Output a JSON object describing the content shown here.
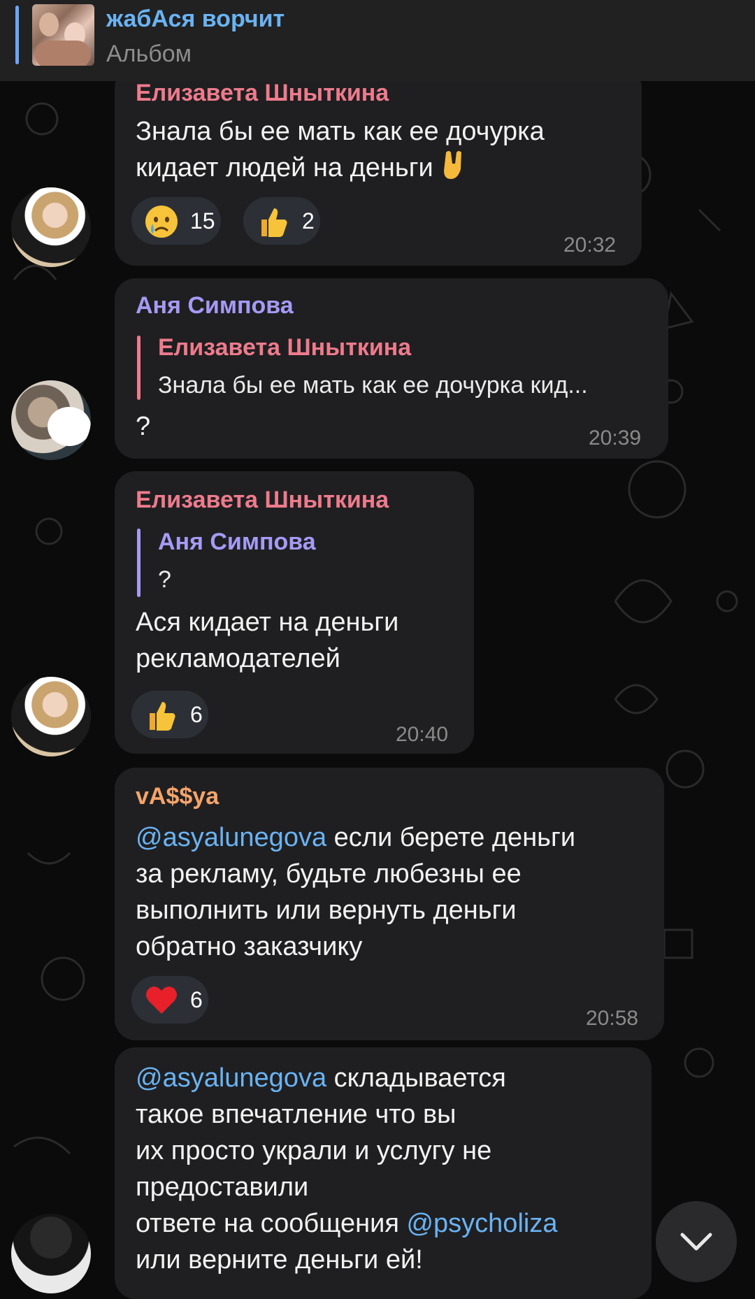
{
  "pinned": {
    "title": "жабАся ворчит",
    "subtitle": "Альбом"
  },
  "messages": [
    {
      "sender": "Елизавета Шныткина",
      "sender_color": "#ee7b8c",
      "lines": [
        "Знала бы ее мать как ее дочурка",
        "кидает людей на деньги"
      ],
      "reactions": [
        {
          "emoji": "crying-face",
          "count": "15"
        },
        {
          "emoji": "thumbs-up",
          "count": "2"
        }
      ],
      "time": "20:32"
    },
    {
      "sender": "Аня Симпова",
      "sender_color": "#a59bf5",
      "reply": {
        "name": "Елизавета Шныткина",
        "text": "Знала бы ее мать как ее дочурка кид...",
        "color": "#ee7b8c"
      },
      "text": "?",
      "time": "20:39"
    },
    {
      "sender": "Елизавета Шныткина",
      "sender_color": "#ee7b8c",
      "reply": {
        "name": "Аня Симпова",
        "text": "?",
        "color": "#a59bf5"
      },
      "lines": [
        "Ася кидает на деньги",
        "рекламодателей"
      ],
      "reactions": [
        {
          "emoji": "thumbs-up",
          "count": "6"
        }
      ],
      "time": "20:40"
    },
    {
      "sender": "vA$$ya",
      "sender_color": "#f5a46a",
      "mention": "@asyalunegova",
      "first_line_rest": " если берете деньги",
      "lines": [
        "за рекламу, будьте любезны ее",
        "выполнить или вернуть деньги",
        "обратно заказчику"
      ],
      "reactions": [
        {
          "emoji": "red-heart",
          "count": "6"
        }
      ],
      "time": "20:58"
    },
    {
      "mention": "@asyalunegova",
      "first_line_rest": " складывается",
      "lines": [
        "такое впечатление что вы",
        "их просто украли и услугу не",
        "предоставили"
      ],
      "line5_prefix": "ответе на сообщения ",
      "mention2": "@psycholiza",
      "last_line": "или верните деньги ей!"
    }
  ],
  "colors": {
    "background": "#0b0b0b",
    "bubble": "#1f1f21",
    "link": "#6ab3f3",
    "time": "#8a8a8a"
  }
}
